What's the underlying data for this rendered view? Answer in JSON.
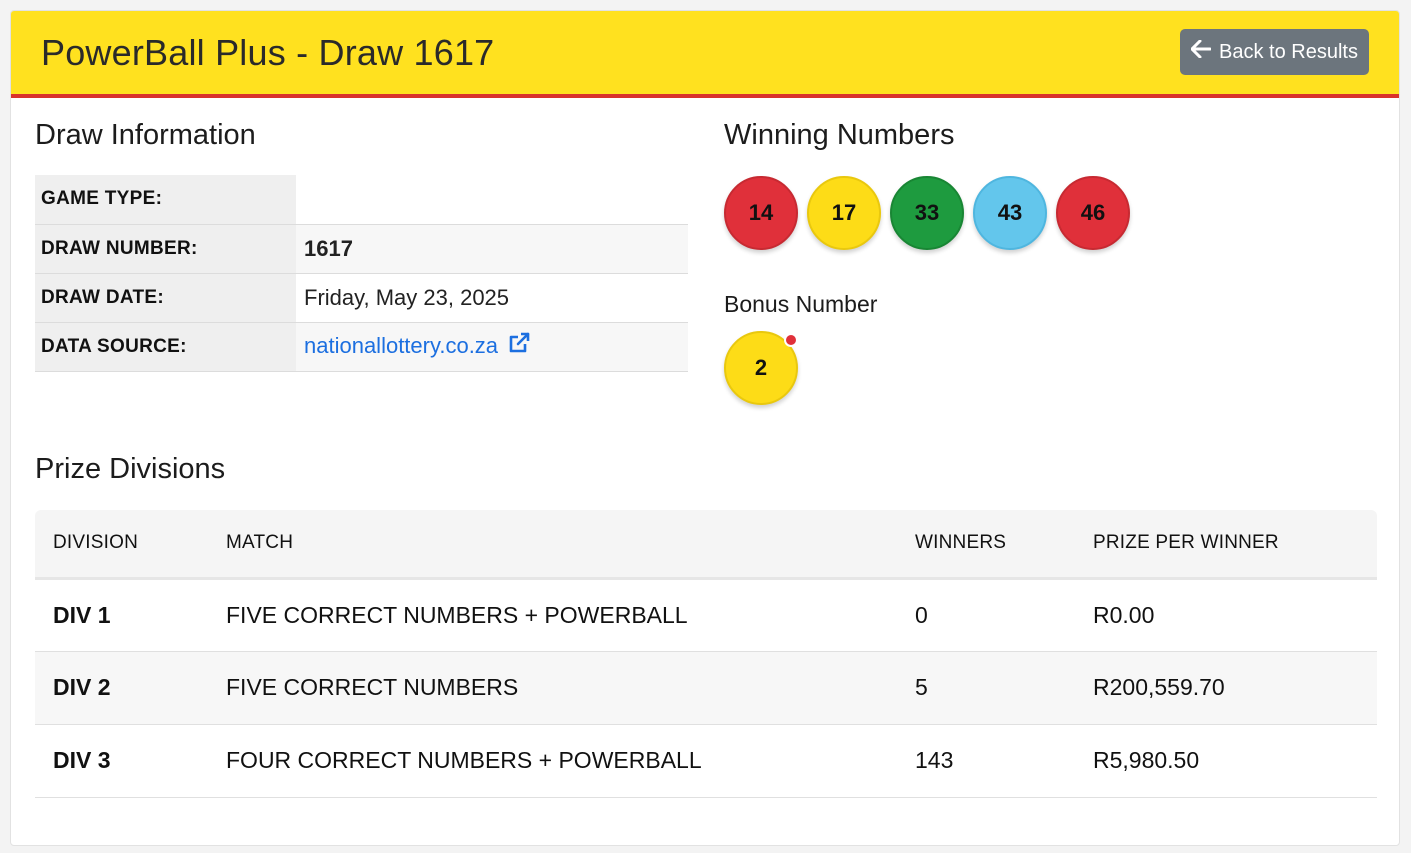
{
  "header": {
    "title": "PowerBall Plus - Draw 1617",
    "back_label": "Back to Results"
  },
  "draw_info": {
    "title": "Draw Information",
    "rows": [
      {
        "label": "GAME TYPE:",
        "value": ""
      },
      {
        "label": "DRAW NUMBER:",
        "value": "1617"
      },
      {
        "label": "DRAW DATE:",
        "value": "Friday, May 23, 2025"
      },
      {
        "label": "DATA SOURCE:",
        "value": "nationallottery.co.za"
      }
    ]
  },
  "winning": {
    "title": "Winning Numbers",
    "balls": [
      {
        "number": "14",
        "color": "#e0303a"
      },
      {
        "number": "17",
        "color": "#fddc17"
      },
      {
        "number": "33",
        "color": "#1e9b3f"
      },
      {
        "number": "43",
        "color": "#63c6ec"
      },
      {
        "number": "46",
        "color": "#e0303a"
      }
    ],
    "bonus_label": "Bonus Number",
    "bonus": {
      "number": "2",
      "color": "#fddc17"
    }
  },
  "prizes": {
    "title": "Prize Divisions",
    "columns": [
      "DIVISION",
      "MATCH",
      "WINNERS",
      "PRIZE PER WINNER"
    ],
    "rows": [
      {
        "division": "DIV 1",
        "match": "FIVE CORRECT NUMBERS + POWERBALL",
        "winners": "0",
        "prize": "R0.00"
      },
      {
        "division": "DIV 2",
        "match": "FIVE CORRECT NUMBERS",
        "winners": "5",
        "prize": "R200,559.70"
      },
      {
        "division": "DIV 3",
        "match": "FOUR CORRECT NUMBERS + POWERBALL",
        "winners": "143",
        "prize": "R5,980.50"
      }
    ]
  },
  "colors": {
    "header_bg": "#ffe11f",
    "header_border": "#d9322b",
    "button_bg": "#6c757d",
    "link": "#1c6fe0"
  }
}
